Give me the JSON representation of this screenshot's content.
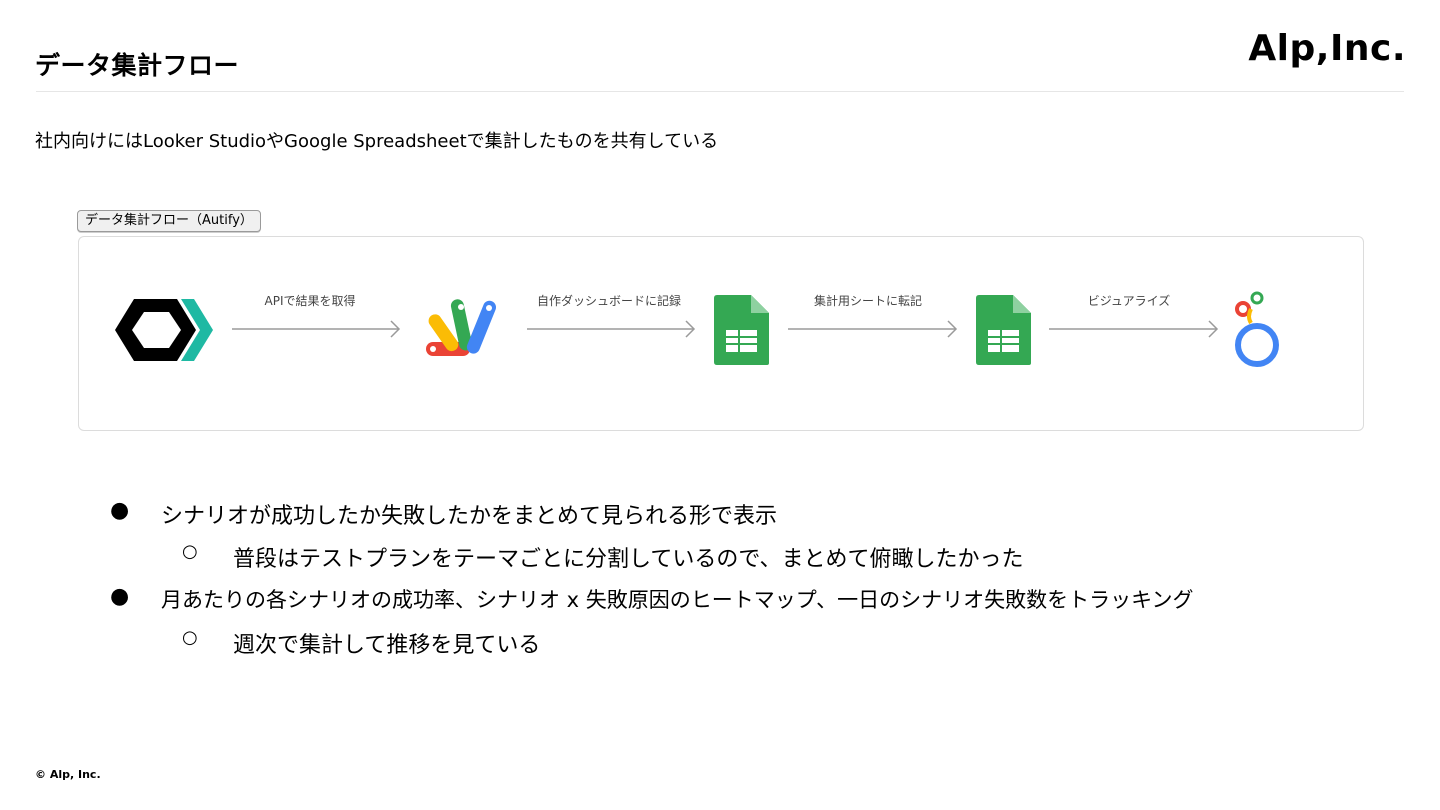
{
  "header": {
    "title": "データ集計フロー",
    "logo": "Alp,Inc."
  },
  "lead": "社内向けにはLooker StudioやGoogle Spreadsheetで集計したものを共有している",
  "flow": {
    "label": "データ集計フロー（Autify）",
    "steps": [
      {
        "icon": "autify-logo-icon"
      },
      {
        "icon": "apps-script-icon"
      },
      {
        "icon": "google-sheets-icon"
      },
      {
        "icon": "google-sheets-icon"
      },
      {
        "icon": "looker-studio-icon"
      }
    ],
    "arrows": [
      "APIで結果を取得",
      "自作ダッシュボードに記録",
      "集計用シートに転記",
      "ビジュアライズ"
    ]
  },
  "bullets": [
    {
      "text": "シナリオが成功したか失敗したかをまとめて見られる形で表示",
      "bullet": "●",
      "sub": [
        {
          "text": "普段はテストプランをテーマごとに分割しているので、まとめて俯瞰したかった",
          "bullet": "○"
        }
      ]
    },
    {
      "text": "月あたりの各シナリオの成功率、シナリオ x 失敗原因のヒートマップ、一日のシナリオ失敗数をトラッキング",
      "bullet": "●",
      "sub": [
        {
          "text": "週次で集計して推移を見ている",
          "bullet": "○"
        }
      ]
    }
  ],
  "footer": "© Alp, Inc.",
  "colors": {
    "autify_teal": "#1fb9a3",
    "sheets_green": "#34a853",
    "arrow_gray": "#9a9a9a"
  }
}
